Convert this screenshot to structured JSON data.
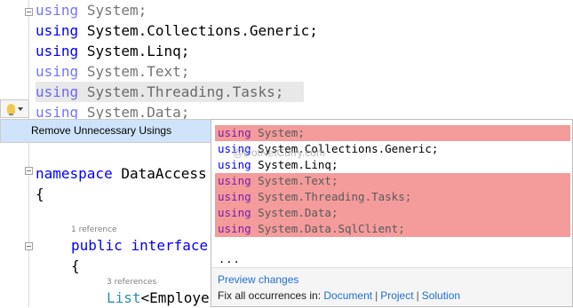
{
  "editor": {
    "usings": [
      {
        "kw": "using",
        "ns": "System;",
        "faded": true
      },
      {
        "kw": "using",
        "ns": "System.Collections.Generic;",
        "faded": false
      },
      {
        "kw": "using",
        "ns": "System.Linq;",
        "faded": false
      },
      {
        "kw": "using",
        "ns": "System.Text;",
        "faded": true
      },
      {
        "kw": "using",
        "ns": "System.Threading.Tasks;",
        "faded": true
      },
      {
        "kw": "using",
        "ns": "System.Data;",
        "faded": true
      }
    ],
    "namespace_kw": "namespace",
    "namespace_name": "DataAccess",
    "open_brace_1": "{",
    "ref_1": "1 reference",
    "public_kw": "public",
    "interface_kw": "interface",
    "open_brace_2": "{",
    "ref_2": "3 references",
    "list_type": "List",
    "list_arg": "<Employe"
  },
  "lightbulb": {
    "icon": "lightbulb-icon",
    "caret": "chevron-down-icon"
  },
  "quick_action_menu": {
    "item": "Remove Unnecessary Usings"
  },
  "preview": {
    "lines": [
      {
        "kw": "using",
        "ns": "System;",
        "removed": true
      },
      {
        "kw": "using",
        "ns": "System.Collections.Generic;",
        "removed": false
      },
      {
        "kw": "using",
        "ns": "System.Linq;",
        "removed": false
      },
      {
        "kw": "using",
        "ns": "System.Text;",
        "removed": true
      },
      {
        "kw": "using",
        "ns": "System.Threading.Tasks;",
        "removed": true
      },
      {
        "kw": "using",
        "ns": "System.Data;",
        "removed": true
      },
      {
        "kw": "using",
        "ns": "System.Data.SqlClient;",
        "removed": true
      }
    ],
    "ellipsis": "...",
    "watermark": "@DotNetCurry.com",
    "preview_changes": "Preview changes",
    "fix_all_label": "Fix all occurrences in:",
    "fix_document": "Document",
    "fix_project": "Project",
    "fix_solution": "Solution",
    "separator": "|"
  }
}
